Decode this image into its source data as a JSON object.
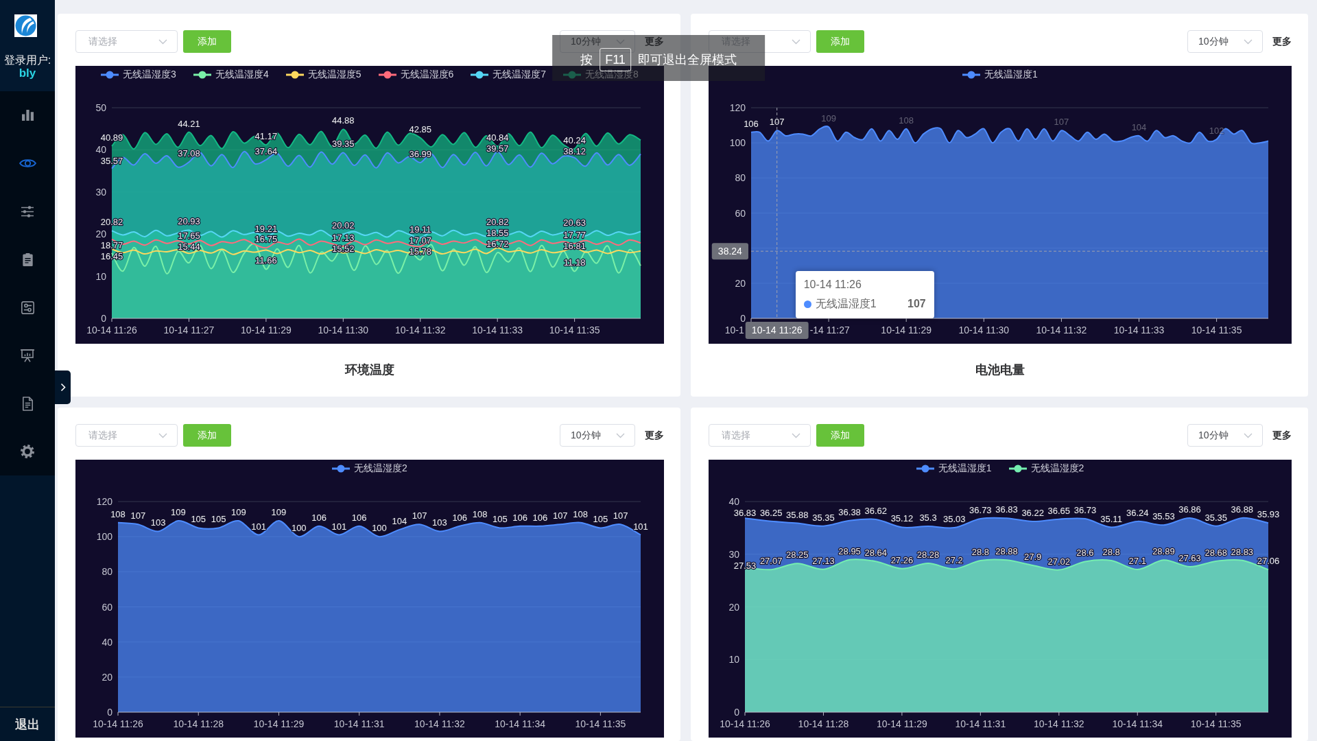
{
  "sidebar": {
    "user_label": "登录用户:",
    "username": "bly",
    "items": [
      {
        "selected": false
      },
      {
        "selected": true
      },
      {
        "selected": false
      },
      {
        "selected": false
      },
      {
        "selected": false
      },
      {
        "selected": false
      },
      {
        "selected": false
      },
      {
        "selected": false
      }
    ],
    "logout": "退出"
  },
  "panels": [
    {
      "select": {
        "placeholder": "请选择"
      },
      "add_button": "添加",
      "range_select": {
        "value": "10分钟"
      },
      "more_link": "更多",
      "chart_data": {
        "type": "area",
        "legend": "top",
        "grid": true,
        "categories": [
          "10-14 11:26",
          null,
          null,
          null,
          null,
          null,
          null,
          "10-14 11:27",
          null,
          null,
          null,
          null,
          null,
          null,
          "10-14 11:29",
          null,
          null,
          null,
          null,
          null,
          null,
          "10-14 11:30",
          null,
          null,
          null,
          null,
          null,
          null,
          "10-14 11:32",
          null,
          null,
          null,
          null,
          null,
          null,
          "10-14 11:33",
          null,
          null,
          null,
          null,
          null,
          null,
          "10-14 11:35",
          null,
          null,
          null,
          null,
          null,
          null
        ],
        "series": [
          {
            "name": "无线温湿度3",
            "color": "#4e8cff",
            "values": [
              35.57,
              38.2,
              36.4,
              39.1,
              36.8,
              38.6,
              35.9,
              37.08,
              39.4,
              36.2,
              38.9,
              35.8,
              39.6,
              36.7,
              37.64,
              39.2,
              36.1,
              38.7,
              35.9,
              39.5,
              36.6,
              39.35,
              36.3,
              38.8,
              35.7,
              39.3,
              36.9,
              38.4,
              36.99,
              39.1,
              35.8,
              38.9,
              36.4,
              39.4,
              36.2,
              39.57,
              36.5,
              38.8,
              35.9,
              39.2,
              36.7,
              38.5,
              38.12,
              36.1,
              39.3,
              36.4,
              38.9,
              36.3,
              39.0
            ]
          },
          {
            "name": "无线温湿度4",
            "color": "#7af0a8",
            "values": [
              15.5,
              11.2,
              16.8,
              12.4,
              17.1,
              10.6,
              15.9,
              13.2,
              17.4,
              11.8,
              16.2,
              10.9,
              15.4,
              17.6,
              11.66,
              16.5,
              12.1,
              17.3,
              10.8,
              15.7,
              13.6,
              16.9,
              11.4,
              17.2,
              12.8,
              16.1,
              10.7,
              15.8,
              13.9,
              17.5,
              11.3,
              16.4,
              12.6,
              17.0,
              10.9,
              15.6,
              13.4,
              16.7,
              11.1,
              17.3,
              12.2,
              16.0,
              11.18,
              15.9,
              13.1,
              17.2,
              10.8,
              16.3,
              12.5
            ]
          },
          {
            "name": "无线温湿度5",
            "color": "#fdd85e",
            "values": [
              16.45,
              15.6,
              16.2,
              15.3,
              16.0,
              15.8,
              16.3,
              15.44,
              16.1,
              15.5,
              16.4,
              15.2,
              16.0,
              15.7,
              16.2,
              15.4,
              16.3,
              15.6,
              16.1,
              15.3,
              16.2,
              15.52,
              16.0,
              15.4,
              16.3,
              15.7,
              16.1,
              15.5,
              15.78,
              16.2,
              15.3,
              16.0,
              15.6,
              16.4,
              15.4,
              16.72,
              15.8,
              16.1,
              15.5,
              16.3,
              15.6,
              16.0,
              16.81,
              15.7,
              16.2,
              15.4,
              16.1,
              15.6,
              16.0
            ]
          },
          {
            "name": "无线温湿度6",
            "color": "#ff6b7b",
            "values": [
              18.77,
              17.6,
              18.3,
              17.4,
              18.6,
              17.8,
              18.4,
              17.65,
              18.5,
              17.3,
              18.2,
              17.9,
              18.7,
              17.5,
              16.75,
              18.1,
              17.6,
              18.8,
              17.4,
              18.3,
              17.7,
              17.13,
              18.4,
              17.5,
              18.6,
              17.8,
              18.2,
              17.4,
              17.07,
              18.5,
              17.6,
              18.3,
              17.9,
              18.7,
              17.5,
              18.55,
              17.7,
              18.4,
              17.3,
              18.6,
              17.8,
              18.2,
              17.77,
              18.5,
              17.6,
              18.3,
              17.4,
              18.6,
              17.9
            ]
          },
          {
            "name": "无线温湿度7",
            "color": "#56d6f5",
            "values": [
              20.82,
              19.8,
              20.5,
              19.4,
              20.9,
              19.6,
              20.3,
              20.93,
              19.7,
              20.6,
              19.3,
              20.8,
              19.9,
              20.4,
              19.21,
              20.7,
              19.5,
              20.2,
              19.8,
              20.9,
              19.4,
              20.02,
              20.6,
              19.7,
              20.4,
              19.3,
              20.8,
              19.9,
              19.11,
              20.5,
              19.6,
              20.9,
              19.8,
              20.3,
              19.5,
              20.82,
              19.9,
              20.6,
              19.4,
              20.7,
              19.8,
              20.4,
              20.63,
              19.6,
              20.8,
              19.7,
              20.5,
              19.9,
              20.6
            ]
          },
          {
            "name": "无线温湿度8",
            "color": "#13b884",
            "values": [
              40.89,
              43.6,
              40.2,
              44.1,
              41.3,
              43.8,
              40.6,
              44.21,
              41.0,
              43.4,
              40.3,
              44.3,
              41.6,
              43.2,
              41.17,
              44.0,
              40.5,
              43.7,
              41.2,
              44.4,
              40.8,
              44.88,
              41.4,
              43.5,
              40.4,
              44.2,
              41.1,
              43.9,
              42.85,
              40.7,
              43.6,
              41.3,
              44.1,
              40.6,
              43.3,
              40.84,
              43.8,
              41.0,
              44.2,
              40.5,
              43.5,
              41.2,
              40.24,
              43.9,
              40.9,
              44.0,
              41.4,
              43.6,
              42.3
            ]
          }
        ],
        "ylim": [
          0,
          50
        ],
        "yticks": [
          0,
          10,
          20,
          30,
          40,
          50
        ],
        "value_labels": [
          [
            "35.57",
            null,
            null,
            null,
            null,
            null,
            null,
            "37.08",
            null,
            null,
            null,
            null,
            null,
            null,
            "37.64",
            null,
            null,
            null,
            null,
            null,
            null,
            "39.35",
            null,
            null,
            null,
            null,
            null,
            null,
            "36.99",
            null,
            null,
            null,
            null,
            null,
            null,
            "39.57",
            null,
            null,
            null,
            null,
            null,
            null,
            "38.12",
            null,
            null,
            null,
            null,
            null,
            null
          ],
          [
            null,
            null,
            null,
            null,
            null,
            null,
            null,
            null,
            null,
            null,
            null,
            null,
            null,
            null,
            "11.66",
            null,
            null,
            null,
            null,
            null,
            null,
            null,
            null,
            null,
            null,
            null,
            null,
            null,
            null,
            null,
            null,
            null,
            null,
            null,
            null,
            null,
            null,
            null,
            null,
            null,
            null,
            null,
            "11.18",
            null,
            null,
            null,
            null,
            null,
            null
          ],
          [
            "16.45",
            null,
            null,
            null,
            null,
            null,
            null,
            "15.44",
            null,
            null,
            null,
            null,
            null,
            null,
            null,
            null,
            null,
            null,
            null,
            null,
            null,
            "15.52",
            null,
            null,
            null,
            null,
            null,
            null,
            "15.78",
            null,
            null,
            null,
            null,
            null,
            null,
            "16.72",
            null,
            null,
            null,
            null,
            null,
            null,
            "16.81",
            null,
            null,
            null,
            null,
            null,
            null
          ],
          [
            "18.77",
            null,
            null,
            null,
            null,
            null,
            null,
            "17.65",
            null,
            null,
            null,
            null,
            null,
            null,
            "16.75",
            null,
            null,
            null,
            null,
            null,
            null,
            "17.13",
            null,
            null,
            null,
            null,
            null,
            null,
            "17.07",
            null,
            null,
            null,
            null,
            null,
            null,
            "18.55",
            null,
            null,
            null,
            null,
            null,
            null,
            "17.77",
            null,
            null,
            null,
            null,
            null,
            null
          ],
          [
            "20.82",
            null,
            null,
            null,
            null,
            null,
            null,
            "20.93",
            null,
            null,
            null,
            null,
            null,
            null,
            "19.21",
            null,
            null,
            null,
            null,
            null,
            null,
            "20.02",
            null,
            null,
            null,
            null,
            null,
            null,
            "19.11",
            null,
            null,
            null,
            null,
            null,
            null,
            "20.82",
            null,
            null,
            null,
            null,
            null,
            null,
            "20.63",
            null,
            null,
            null,
            null,
            null,
            null
          ],
          [
            "40.89",
            null,
            null,
            null,
            null,
            null,
            null,
            "44.21",
            null,
            null,
            null,
            null,
            null,
            null,
            "41.17",
            null,
            null,
            null,
            null,
            null,
            null,
            "44.88",
            null,
            null,
            null,
            null,
            null,
            null,
            "42.85",
            null,
            null,
            null,
            null,
            null,
            null,
            "40.84",
            null,
            null,
            null,
            null,
            null,
            null,
            "40.24",
            null,
            null,
            null,
            null,
            null,
            null
          ]
        ]
      },
      "title": "环境温度"
    },
    {
      "select": {
        "placeholder": "请选择"
      },
      "add_button": "添加",
      "range_select": {
        "value": "10分钟"
      },
      "more_link": "更多",
      "chart_data": {
        "type": "area",
        "legend": "top",
        "grid": true,
        "categories": [
          null,
          null,
          null,
          null,
          null,
          null,
          null,
          null,
          null,
          null,
          null,
          null,
          null,
          null,
          null,
          null,
          null,
          null,
          "10-14 11:29",
          null,
          null,
          null,
          null,
          null,
          null,
          null,
          null,
          "10-14 11:30",
          null,
          null,
          null,
          null,
          null,
          null,
          null,
          null,
          "10-14 11:32",
          null,
          null,
          null,
          null,
          null,
          null,
          null,
          null,
          "10-14 11:33",
          null,
          null,
          null,
          null,
          null,
          null,
          null,
          null,
          "10-14 11:35",
          null,
          null,
          null,
          null,
          null,
          null
        ],
        "series": [
          {
            "name": "无线温湿度1",
            "color": "#4e8cff",
            "values": [
              106,
              106,
              101,
              107,
              104,
              105,
              105,
              104,
              108,
              109,
              101,
              106,
              103,
              102,
              108,
              101,
              107,
              102,
              108,
              100,
              105,
              108,
              108,
              100,
              107,
              103,
              105,
              108,
              100,
              106,
              108,
              101,
              108,
              102,
              108,
              101,
              107,
              104,
              101,
              106,
              102,
              105,
              101,
              101,
              103,
              104,
              101,
              107,
              103,
              104,
              101,
              100,
              106,
              101,
              102,
              108,
              105,
              107,
              100,
              100,
              101
            ]
          }
        ],
        "ylim": [
          0,
          120
        ],
        "yticks": [
          0,
          20,
          60,
          80,
          100,
          120
        ],
        "value_labels": [
          [
            "106",
            null,
            null,
            "107",
            null,
            null,
            null,
            null,
            null,
            "109",
            null,
            null,
            null,
            null,
            null,
            null,
            null,
            null,
            "108",
            null,
            null,
            null,
            null,
            null,
            null,
            null,
            null,
            null,
            null,
            null,
            null,
            null,
            null,
            null,
            null,
            null,
            "107",
            null,
            null,
            null,
            null,
            null,
            null,
            null,
            null,
            "104",
            null,
            null,
            null,
            null,
            null,
            null,
            null,
            null,
            "102",
            null,
            null,
            null,
            null,
            null,
            null
          ]
        ],
        "ref_lines": [
          {
            "axis": "y",
            "value": 38.24,
            "label": "38.24"
          }
        ]
      },
      "label_states": [
        {
          "faded": false
        },
        {
          "faded": false
        },
        {
          "faded": true
        },
        {
          "faded": true
        },
        {
          "faded": true
        },
        {
          "faded": true
        },
        {
          "faded": true
        }
      ],
      "hover": {
        "x_label": "10-14 11:26",
        "covered_left": "10-1",
        "covered_right": "-14 11:27",
        "tooltip": {
          "title": "10-14 11:26",
          "series": "无线温湿度1",
          "value": "107"
        }
      },
      "title": "电池电量"
    },
    {
      "select": {
        "placeholder": "请选择"
      },
      "add_button": "添加",
      "range_select": {
        "value": "10分钟"
      },
      "more_link": "更多",
      "chart_data": {
        "type": "area",
        "legend": "top",
        "grid": true,
        "categories": [
          "10-14 11:26",
          null,
          null,
          null,
          "10-14 11:28",
          null,
          null,
          null,
          "10-14 11:29",
          null,
          null,
          null,
          "10-14 11:31",
          null,
          null,
          null,
          "10-14 11:32",
          null,
          null,
          null,
          "10-14 11:34",
          null,
          null,
          null,
          "10-14 11:35",
          null,
          null
        ],
        "series": [
          {
            "name": "无线温湿度2",
            "color": "#4e8cff",
            "values": [
              108,
              107,
              103,
              109,
              105,
              105,
              109,
              101,
              109,
              100,
              106,
              101,
              106,
              100,
              104,
              107,
              103,
              106,
              108,
              105,
              106,
              106,
              107,
              108,
              105,
              107,
              101
            ]
          }
        ],
        "ylim": [
          0,
          120
        ],
        "yticks": [
          0,
          20,
          40,
          60,
          80,
          100,
          120
        ],
        "data_labels": true
      }
    },
    {
      "select": {
        "placeholder": "请选择"
      },
      "add_button": "添加",
      "range_select": {
        "value": "10分钟"
      },
      "more_link": "更多",
      "chart_data": {
        "type": "area",
        "legend": "top",
        "grid": true,
        "categories": [
          "10-14 11:26",
          null,
          null,
          "10-14 11:28",
          null,
          null,
          "10-14 11:29",
          null,
          null,
          "10-14 11:31",
          null,
          null,
          "10-14 11:32",
          null,
          null,
          "10-14 11:34",
          null,
          null,
          "10-14 11:35",
          null,
          null
        ],
        "series": [
          {
            "name": "无线温湿度1",
            "color": "#4e8cff",
            "values": [
              36.83,
              36.25,
              35.88,
              35.35,
              36.38,
              36.62,
              35.12,
              35.3,
              35.03,
              36.73,
              36.83,
              36.22,
              36.65,
              36.73,
              35.11,
              36.24,
              35.53,
              36.86,
              35.35,
              36.88,
              35.93
            ]
          },
          {
            "name": "无线温湿度2",
            "color": "#75eeb0",
            "values": [
              27.53,
              27.07,
              28.25,
              27.13,
              28.95,
              28.64,
              27.26,
              28.28,
              27.2,
              28.8,
              28.88,
              27.9,
              27.02,
              28.6,
              28.8,
              27.1,
              28.89,
              27.63,
              28.68,
              28.83,
              27.06
            ]
          }
        ],
        "ylim": [
          0,
          40
        ],
        "yticks": [
          0,
          10,
          20,
          30,
          40
        ],
        "data_labels": true
      }
    }
  ],
  "fullscreen_notice": {
    "before": "按",
    "key": "F11",
    "after": "即可退出全屏模式"
  }
}
